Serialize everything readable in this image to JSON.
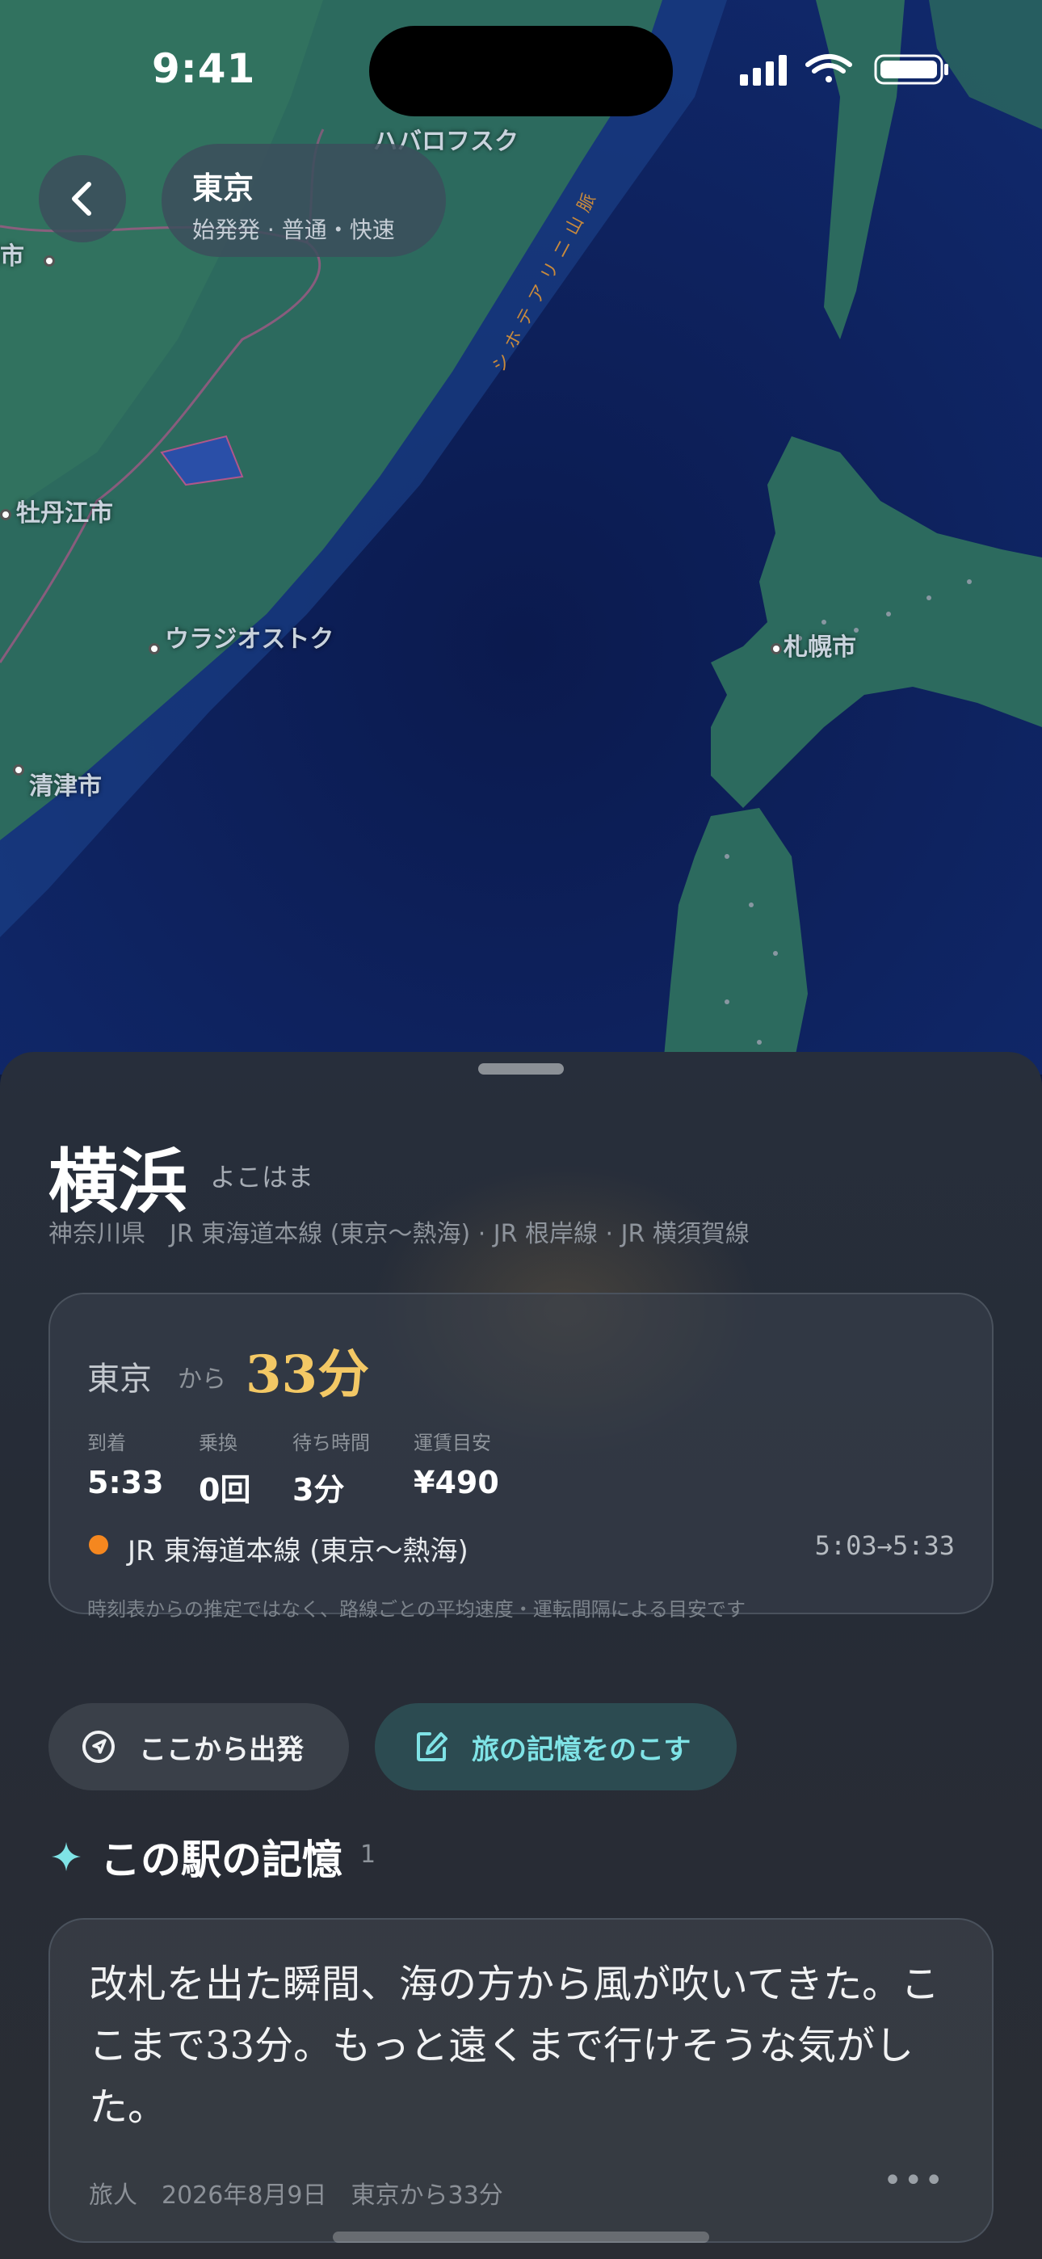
{
  "status_bar": {
    "time": "9:41"
  },
  "map": {
    "labels": [
      {
        "id": "khabarovsk",
        "text": "ハバロフスク"
      },
      {
        "id": "left-city",
        "text": "岡市"
      },
      {
        "id": "mudanjiang",
        "text": "牡丹江市"
      },
      {
        "id": "vladivostok",
        "text": "ウラジオストク"
      },
      {
        "id": "chongjin",
        "text": "清津市"
      },
      {
        "id": "sapporo",
        "text": "札幌市"
      },
      {
        "id": "sikhote-alin",
        "text": "シホテアリニ山脈"
      }
    ]
  },
  "nav": {
    "origin_name": "東京",
    "origin_sub": "始発発 · 普通・快速"
  },
  "station": {
    "name": "横浜",
    "kana": "よこはま",
    "lines": "神奈川県　JR 東海道本線 (東京〜熱海) · JR 根岸線 · JR 横須賀線"
  },
  "route": {
    "from": "東京",
    "from_suffix": "から",
    "duration": "33分",
    "stats": [
      {
        "label": "到着",
        "value": "5:33"
      },
      {
        "label": "乗換",
        "value": "0回"
      },
      {
        "label": "待ち時間",
        "value": "3分"
      },
      {
        "label": "運賃目安",
        "value": "¥490"
      }
    ],
    "line_name": "JR 東海道本線 (東京〜熱海)",
    "line_color": "#f5871f",
    "line_times": "5:03→5:33",
    "note": "時刻表からの推定ではなく、路線ごとの平均速度・運転間隔による目安です"
  },
  "actions": {
    "depart_label": "ここから出発",
    "memory_label": "旅の記憶をのこす"
  },
  "memories": {
    "title": "この駅の記憶",
    "count": "1",
    "items": [
      {
        "text": "改札を出た瞬間、海の方から風が吹いてきた。ここまで33分。もっと遠くまで行けそうな気がした。",
        "meta": "旅人　2026年8月9日　東京から33分"
      }
    ]
  },
  "colors": {
    "accent_gold": "#f3c865",
    "accent_teal": "#7fe3e6",
    "sheet_bg": "#262c36"
  }
}
